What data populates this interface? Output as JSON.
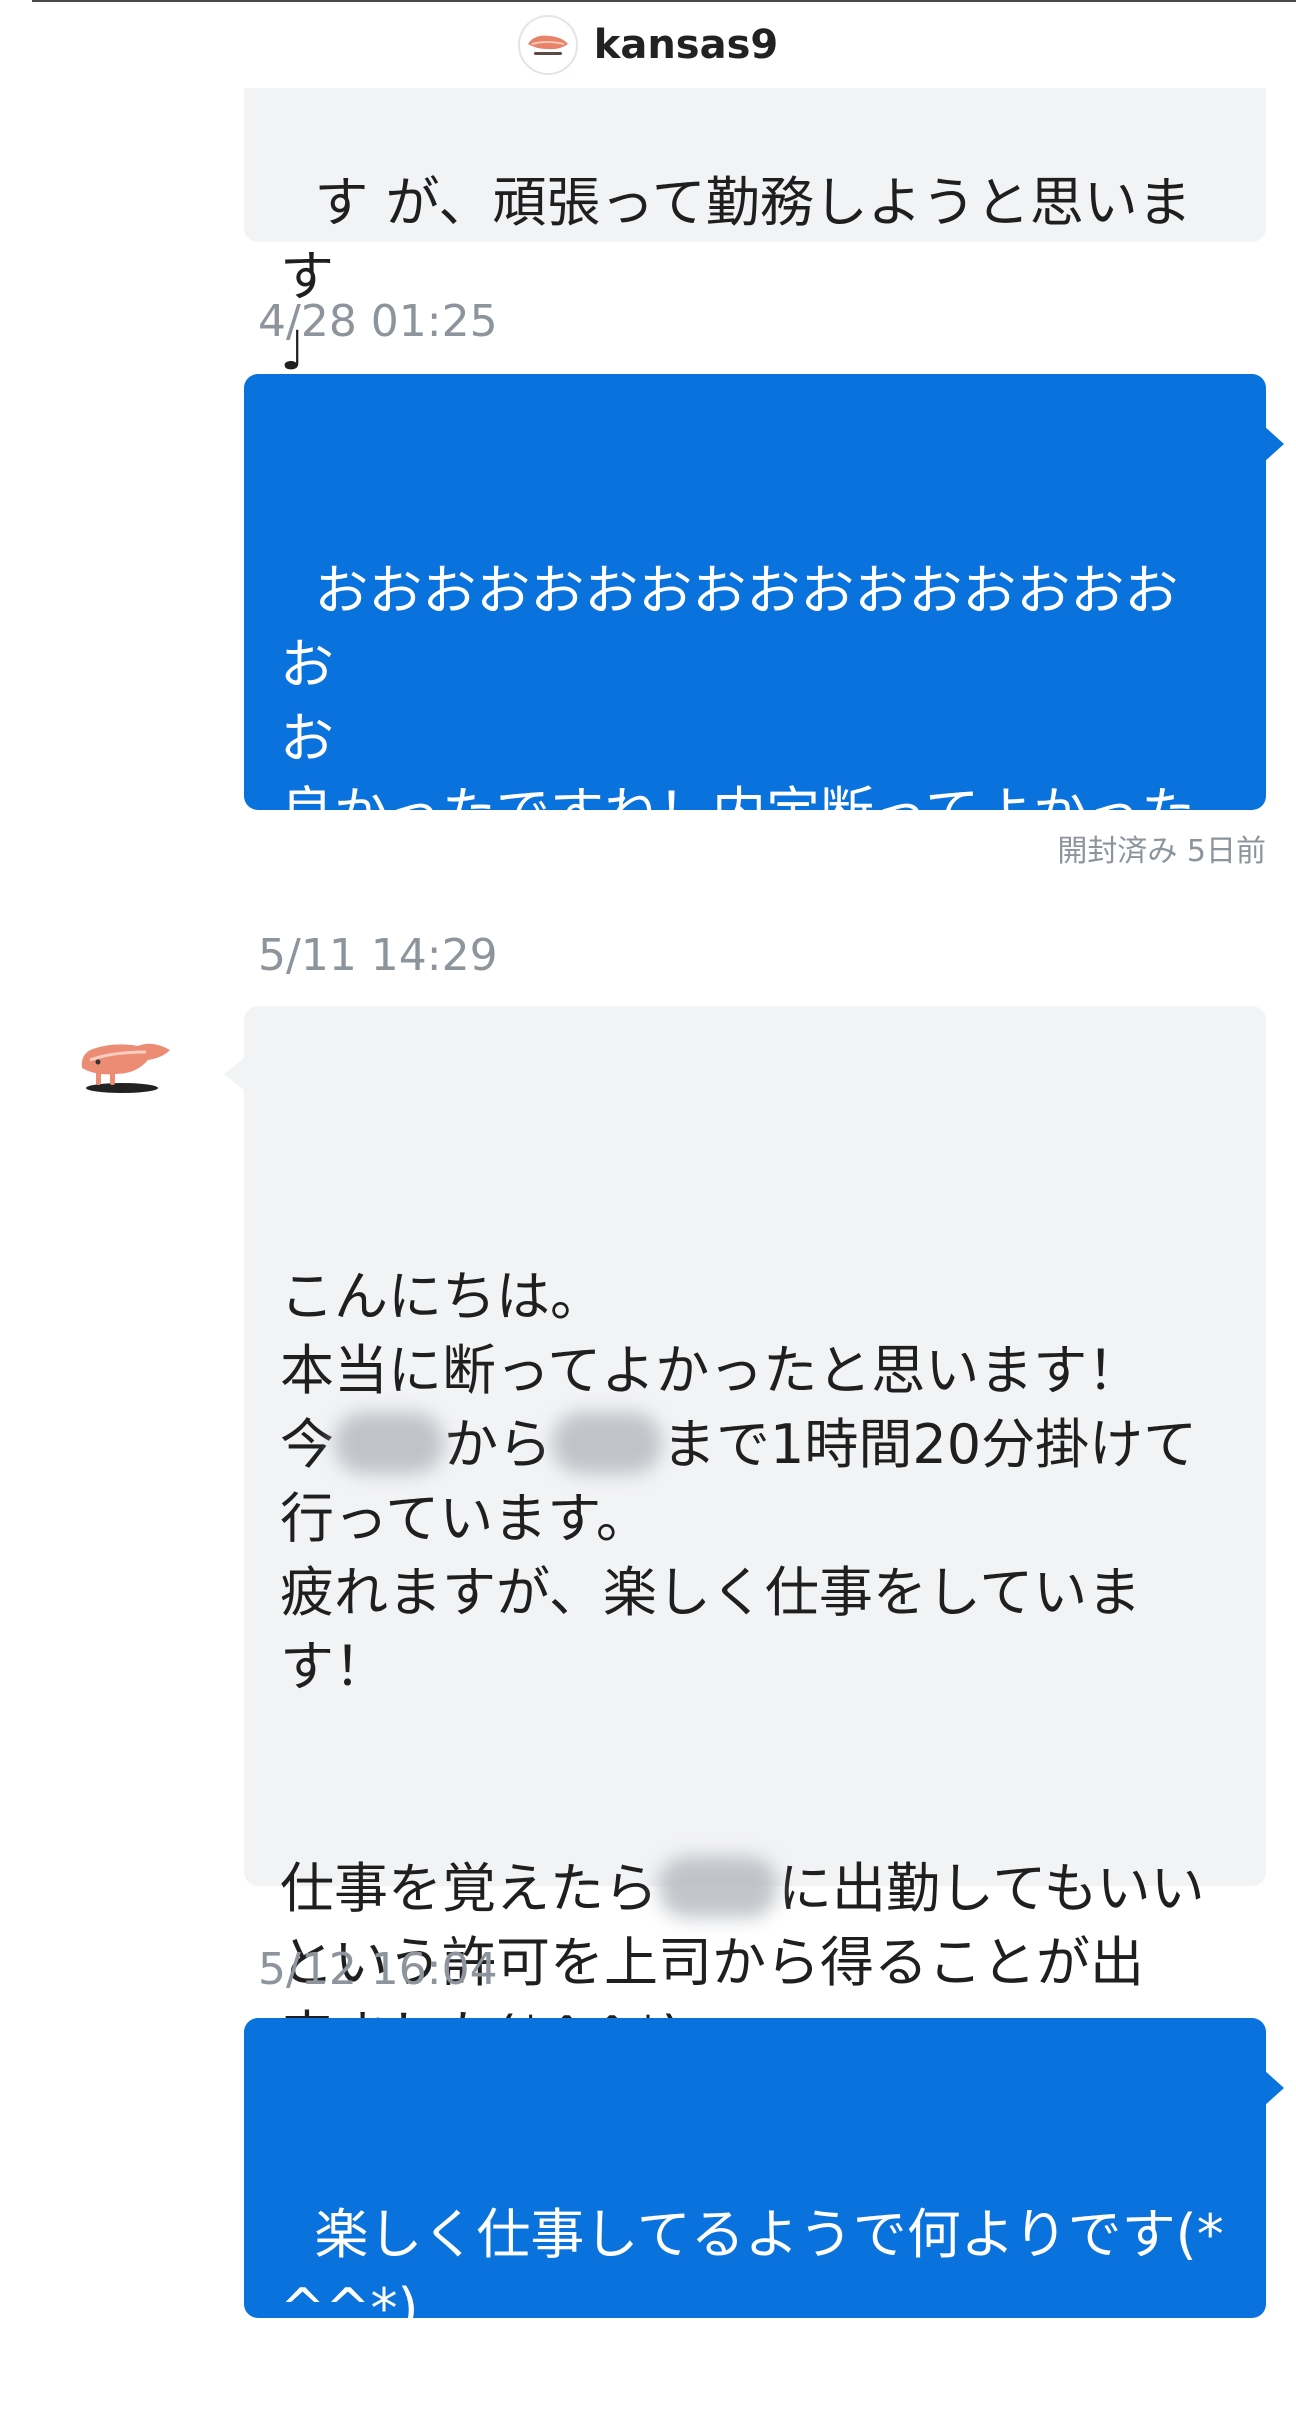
{
  "header": {
    "name": "kansas9",
    "avatar_icon": "salmon-avatar-icon"
  },
  "messages": [
    {
      "type": "in",
      "text": "す が、頑張って勤務しようと思います\n♩"
    },
    {
      "timestamp": "4/28 01:25"
    },
    {
      "type": "out",
      "text": "おおおおおおおおおおおおおおおおお\nお\n良かったですね！内定断ってよかったですね。\nおめでとうございます(⌒∇⌒)",
      "read_status": "開封済み 5日前"
    },
    {
      "timestamp": "5/11 14:29"
    },
    {
      "type": "in",
      "lines": {
        "l1": "こんにちは。",
        "l2": "本当に断ってよかったと思います！",
        "l3a": "今",
        "l3b": "から",
        "l3c": "まで1時間20分掛けて",
        "l4": "行っています。",
        "l5": "疲れますが、楽しく仕事をしていま",
        "l6": "す！",
        "l7a": "仕事を覚えたら",
        "l7b": "に出勤してもいい",
        "l8": "という許可を上司から得ることが出",
        "l9": "来ました(*^^*)"
      }
    },
    {
      "timestamp": "5/12 16:04"
    },
    {
      "type": "out",
      "text": "楽しく仕事してるようで何よりです(*\n^^*)\n占いの力は偉大ですね！"
    }
  ],
  "colors": {
    "outgoing_bubble": "#0a72dd",
    "incoming_bubble": "#f2f3f5",
    "timestamp": "#8d949b"
  }
}
